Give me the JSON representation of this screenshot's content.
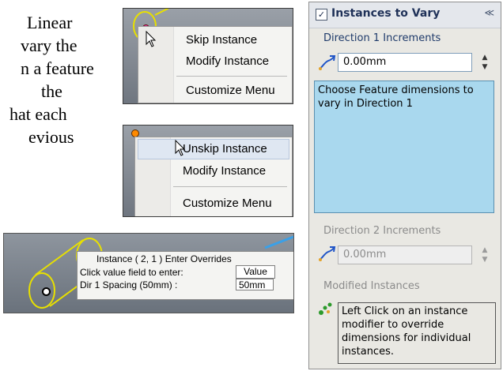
{
  "document": {
    "lines": [
      "Linear",
      "vary the",
      "n a feature",
      "the",
      "hat each",
      "evious"
    ]
  },
  "skip_menu": {
    "items": [
      "Skip Instance",
      "Modify Instance",
      "Customize Menu"
    ]
  },
  "unskip_menu": {
    "items": [
      "Unskip Instance",
      "Modify Instance",
      "Customize Menu"
    ]
  },
  "overrides_panel": {
    "title": "Instance ( 2, 1 ) Enter Overrides",
    "prompt": "Click value field to enter:",
    "value_header": "Value",
    "dir1_label": "Dir 1 Spacing (50mm) :",
    "dir1_value": "50mm"
  },
  "property_manager": {
    "title": "Instances to Vary",
    "checked_glyph": "✓",
    "collapse_glyph": "≪",
    "direction1_label": "Direction 1 Increments",
    "direction1_value": "0.00mm",
    "direction1_hint": "Choose Feature dimensions to vary in Direction 1",
    "direction2_label": "Direction 2 Increments",
    "direction2_value": "0.00mm",
    "modified_label": "Modified Instances",
    "modified_message": "Left Click on an instance modifier to override dimensions for individual instances."
  },
  "icons": [
    "increment-icon",
    "pattern-seed-icon",
    "cursor-arrow-icon",
    "spin-up-icon",
    "spin-down-icon"
  ],
  "colors": {
    "hint_box": "#a9d8ee",
    "sketch_yellow": "#e8e000",
    "point_magenta": "#e23bb4",
    "heading_blue": "#1f3158"
  }
}
